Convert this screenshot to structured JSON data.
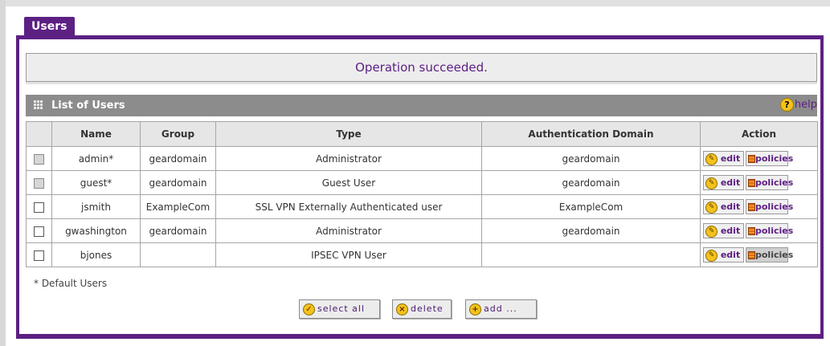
{
  "tab": {
    "label": "Users"
  },
  "status": {
    "message": "Operation succeeded."
  },
  "list": {
    "title": "List of Users",
    "help_label": "help",
    "columns": [
      "Name",
      "Group",
      "Type",
      "Authentication Domain",
      "Action"
    ],
    "rows": [
      {
        "name": "admin*",
        "group": "geardomain",
        "type": "Administrator",
        "domain": "geardomain",
        "checkbox_disabled": true
      },
      {
        "name": "guest*",
        "group": "geardomain",
        "type": "Guest User",
        "domain": "geardomain",
        "checkbox_disabled": true
      },
      {
        "name": "jsmith",
        "group": "ExampleCom",
        "type": "SSL VPN Externally Authenticated user",
        "domain": "ExampleCom",
        "checkbox_disabled": false
      },
      {
        "name": "gwashington",
        "group": "geardomain",
        "type": "Administrator",
        "domain": "geardomain",
        "checkbox_disabled": false
      },
      {
        "name": "bjones",
        "group": "",
        "type": "IPSEC VPN User",
        "domain": "",
        "checkbox_disabled": false
      }
    ],
    "edit_label": "edit",
    "policies_label": "policies"
  },
  "footnote": "* Default Users",
  "buttons": {
    "select_all": "select all",
    "delete": "delete",
    "add": "add ..."
  },
  "colors": {
    "brand_purple": "#5c2083",
    "header_gray": "#8c8c8c",
    "icon_yellow": "#f4c21b"
  },
  "icons": {
    "list": "grid-icon",
    "help": "help-circle-icon",
    "edit": "pencil-circle-icon",
    "policies": "policy-list-icon",
    "select_all": "check-circle-icon",
    "delete": "x-circle-icon",
    "add": "plus-circle-icon"
  }
}
